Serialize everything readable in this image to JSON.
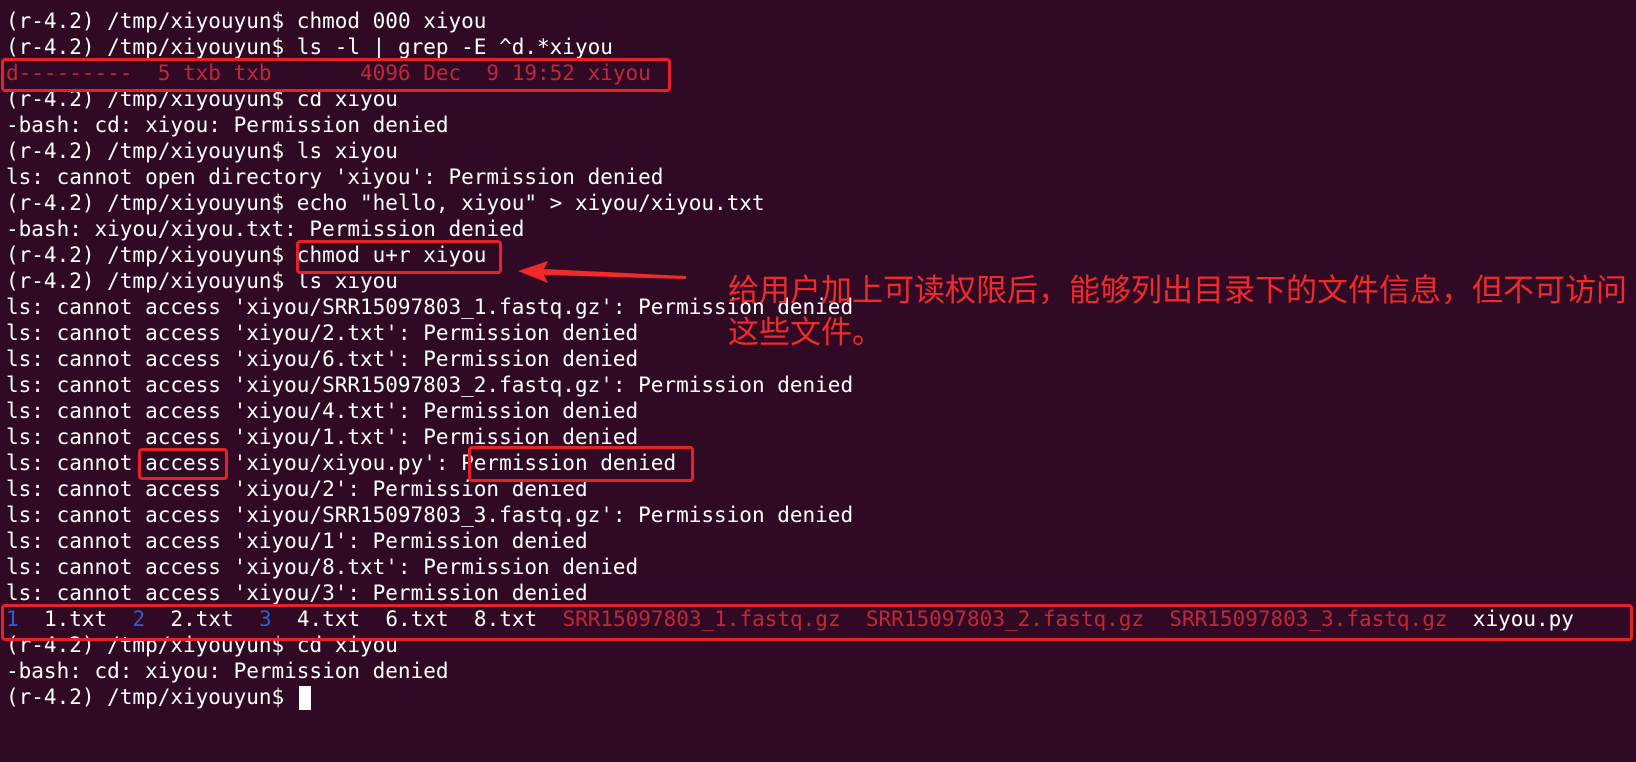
{
  "terminal": {
    "lines": [
      {
        "prompt": "(r-4.2) /tmp/xiyouyun$ ",
        "command": "chmod 000 xiyou"
      },
      {
        "prompt": "(r-4.2) /tmp/xiyouyun$ ",
        "command": "ls -l | grep -E ^d.*xiyou"
      },
      {
        "text": "d---------  5 txb txb       4096 Dec  9 19:52 xiyou"
      },
      {
        "prompt": "(r-4.2) /tmp/xiyouyun$ ",
        "command": "cd xiyou"
      },
      {
        "text": "-bash: cd: xiyou: Permission denied"
      },
      {
        "prompt": "(r-4.2) /tmp/xiyouyun$ ",
        "command": "ls xiyou"
      },
      {
        "text": "ls: cannot open directory 'xiyou': Permission denied"
      },
      {
        "prompt": "(r-4.2) /tmp/xiyouyun$ ",
        "command": "echo \"hello, xiyou\" > xiyou/xiyou.txt"
      },
      {
        "text": "-bash: xiyou/xiyou.txt: Permission denied"
      },
      {
        "prompt": "(r-4.2) /tmp/xiyouyun$ ",
        "command": "chmod u+r xiyou"
      },
      {
        "prompt": "(r-4.2) /tmp/xiyouyun$ ",
        "command": "ls xiyou"
      },
      {
        "text": "ls: cannot access 'xiyou/SRR15097803_1.fastq.gz': Permission denied"
      },
      {
        "text": "ls: cannot access 'xiyou/2.txt': Permission denied"
      },
      {
        "text": "ls: cannot access 'xiyou/6.txt': Permission denied"
      },
      {
        "text": "ls: cannot access 'xiyou/SRR15097803_2.fastq.gz': Permission denied"
      },
      {
        "text": "ls: cannot access 'xiyou/4.txt': Permission denied"
      },
      {
        "text": "ls: cannot access 'xiyou/1.txt': Permission denied"
      },
      {
        "text": "ls: cannot access 'xiyou/xiyou.py': Permission denied"
      },
      {
        "text": "ls: cannot access 'xiyou/2': Permission denied"
      },
      {
        "text": "ls: cannot access 'xiyou/SRR15097803_3.fastq.gz': Permission denied"
      },
      {
        "text": "ls: cannot access 'xiyou/1': Permission denied"
      },
      {
        "text": "ls: cannot access 'xiyou/8.txt': Permission denied"
      },
      {
        "text": "ls: cannot access 'xiyou/3': Permission denied"
      },
      {
        "listing": [
          "1",
          "1.txt",
          "2",
          "2.txt",
          "3",
          "4.txt",
          "6.txt",
          "8.txt",
          "SRR15097803_1.fastq.gz",
          "SRR15097803_2.fastq.gz",
          "SRR15097803_3.fastq.gz",
          "xiyou.py"
        ]
      },
      {
        "prompt": "(r-4.2) /tmp/xiyouyun$ ",
        "command": "cd xiyou"
      },
      {
        "text": "-bash: cd: xiyou: Permission denied"
      },
      {
        "prompt": "(r-4.2) /tmp/xiyouyun$ ",
        "command": ""
      }
    ]
  },
  "annotation": {
    "text": "给用户加上可读权限后，能够列出目录下的文件信息，但不可访问这些文件。"
  },
  "colors": {
    "background": "#300a24",
    "foreground": "#ffffff",
    "directory_listing_red": "#c0283a",
    "directory_listing_blue": "#2c5fd0",
    "highlight_box": "#e8202a",
    "annotation_text": "#f02a2a"
  }
}
